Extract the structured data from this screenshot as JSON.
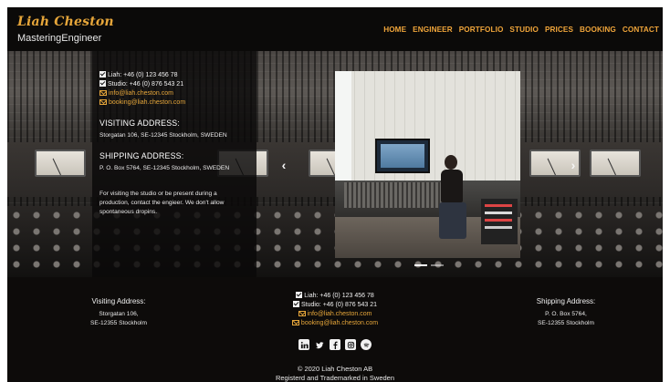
{
  "brand": {
    "script": "Liah Cheston",
    "subtitle": "MasteringEngineer"
  },
  "nav": [
    "HOME",
    "ENGINEER",
    "PORTFOLIO",
    "STUDIO",
    "PRICES",
    "BOOKING",
    "CONTACT"
  ],
  "info": {
    "phone_liah": "Liah: +46 (0) 123 456 78",
    "phone_studio": "Studio: +46 (0) 876 543 21",
    "email_info": "info@liah.cheston.com",
    "email_booking": "booking@liah.cheston.com",
    "visiting_heading": "VISITING ADDRESS:",
    "visiting_address": "Storgatan 106, SE-12345 Stockholm, SWEDEN",
    "shipping_heading": "SHIPPING ADDRESS:",
    "shipping_address": "P. O. Box 5764, SE-12345 Stockholm, SWEDEN",
    "note": "For visiting the studio or be present during a production, contact the engieer. We don't allow spontaneous dropins."
  },
  "carousel": {
    "prev_glyph": "‹",
    "next_glyph": "›",
    "slide_count": 2,
    "active_index": 0
  },
  "footer": {
    "visiting_heading": "Visiting Address:",
    "visiting_line1": "Storgatan 106,",
    "visiting_line2": "SE-12355 Stockholm",
    "shipping_heading": "Shipping Address:",
    "shipping_line1": "P. O. Box 5764,",
    "shipping_line2": "SE-12355 Stockholm",
    "phone_liah": "Liah: +46 (0) 123 456 78",
    "phone_studio": "Studio: +46 (0) 876 543 21",
    "email_info": "info@liah.cheston.com",
    "email_booking": "booking@liah.cheston.com",
    "social_icons": [
      "linkedin-icon",
      "twitter-icon",
      "facebook-icon",
      "instagram-icon",
      "spotify-icon"
    ],
    "copyright": "© 2020 Liah Cheston AB",
    "trademark": "Registerd and Trademarked in Sweden"
  },
  "colors": {
    "accent": "#e6a63a",
    "background": "#0d0b0a",
    "text": "#f2f2f2"
  }
}
